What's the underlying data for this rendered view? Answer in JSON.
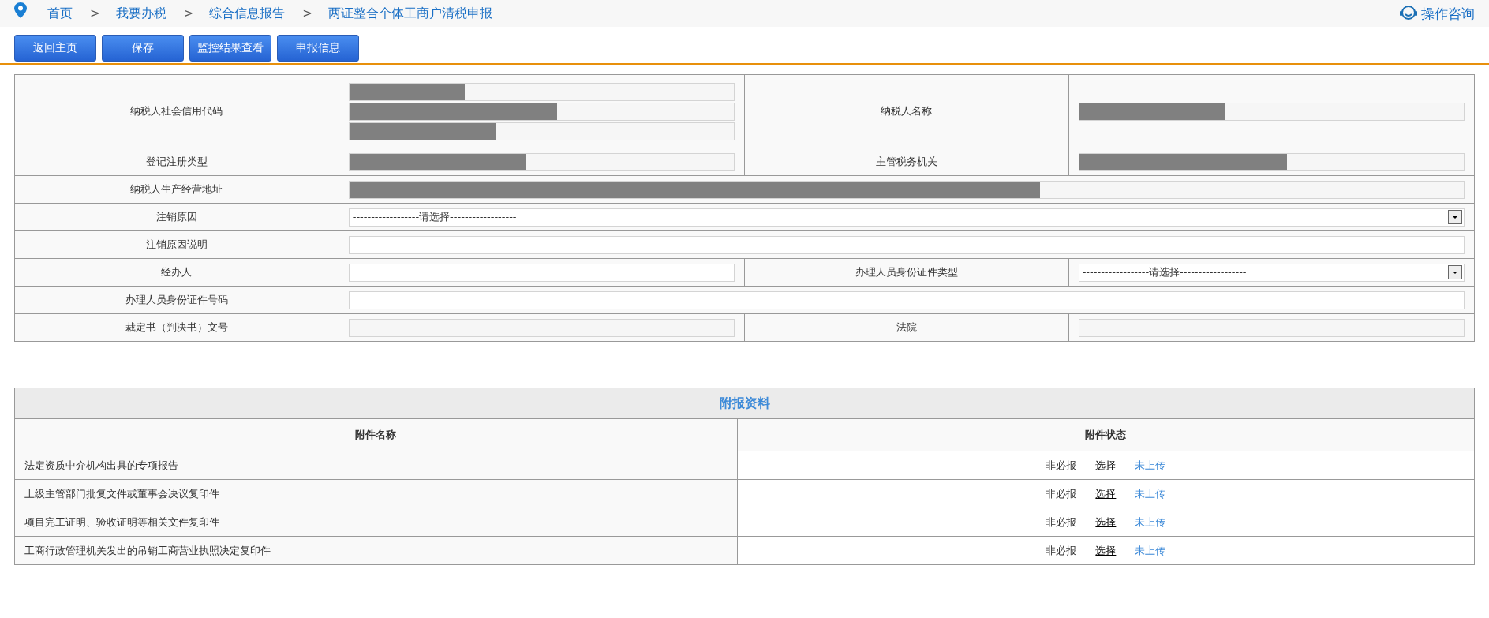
{
  "breadcrumb": [
    {
      "label": "首页"
    },
    {
      "separator": ">",
      "label": "我要办税"
    },
    {
      "separator": ">",
      "label": "综合信息报告"
    },
    {
      "separator": ">",
      "label": "两证整合个体工商户清税申报"
    }
  ],
  "help_link": "操作咨询",
  "toolbar": [
    "返回主页",
    "保存",
    "监控结果查看",
    "申报信息"
  ],
  "form_rows": [
    {
      "cells": [
        {
          "label": "纳税人社会信用代码",
          "fields": [
            {
              "kind": "redacted"
            },
            {
              "kind": "redacted"
            },
            {
              "kind": "redacted"
            }
          ]
        },
        {
          "label": "纳税人名称",
          "fields": [
            {
              "kind": "redacted"
            }
          ]
        }
      ]
    },
    {
      "cells": [
        {
          "label": "登记注册类型",
          "fields": [
            {
              "kind": "redacted"
            }
          ]
        },
        {
          "label": "主管税务机关",
          "fields": [
            {
              "kind": "redacted"
            }
          ]
        }
      ]
    },
    {
      "cells": [
        {
          "label": "纳税人生产经营地址",
          "fields": [
            {
              "kind": "redacted"
            }
          ]
        }
      ]
    },
    {
      "cells": [
        {
          "label": "注销原因",
          "fields": [
            {
              "kind": "select",
              "value": "------------------请选择------------------"
            }
          ]
        }
      ]
    },
    {
      "cells": [
        {
          "label": "注销原因说明",
          "fields": [
            {
              "kind": "text"
            }
          ]
        }
      ]
    },
    {
      "cells": [
        {
          "label": "经办人",
          "fields": [
            {
              "kind": "text"
            }
          ]
        },
        {
          "label": "办理人员身份证件类型",
          "fields": [
            {
              "kind": "select",
              "value": "------------------请选择------------------"
            }
          ]
        }
      ]
    },
    {
      "cells": [
        {
          "label": "办理人员身份证件号码",
          "fields": [
            {
              "kind": "text"
            }
          ]
        }
      ]
    },
    {
      "cells": [
        {
          "label": "裁定书（判决书）文号",
          "fields": [
            {
              "kind": "readonly"
            }
          ]
        },
        {
          "label": "法院",
          "fields": [
            {
              "kind": "readonly"
            }
          ]
        }
      ]
    }
  ],
  "attachments": {
    "title": "附报资料",
    "columns": [
      "附件名称",
      "附件状态"
    ],
    "rows": [
      {
        "name": "法定资质中介机构出具的专项报告",
        "required": "非必报",
        "action": "选择",
        "status": "未上传"
      },
      {
        "name": "上级主管部门批复文件或董事会决议复印件",
        "required": "非必报",
        "action": "选择",
        "status": "未上传"
      },
      {
        "name": "项目完工证明、验收证明等相关文件复印件",
        "required": "非必报",
        "action": "选择",
        "status": "未上传"
      },
      {
        "name": "工商行政管理机关发出的吊销工商营业执照决定复印件",
        "required": "非必报",
        "action": "选择",
        "status": "未上传"
      }
    ]
  }
}
